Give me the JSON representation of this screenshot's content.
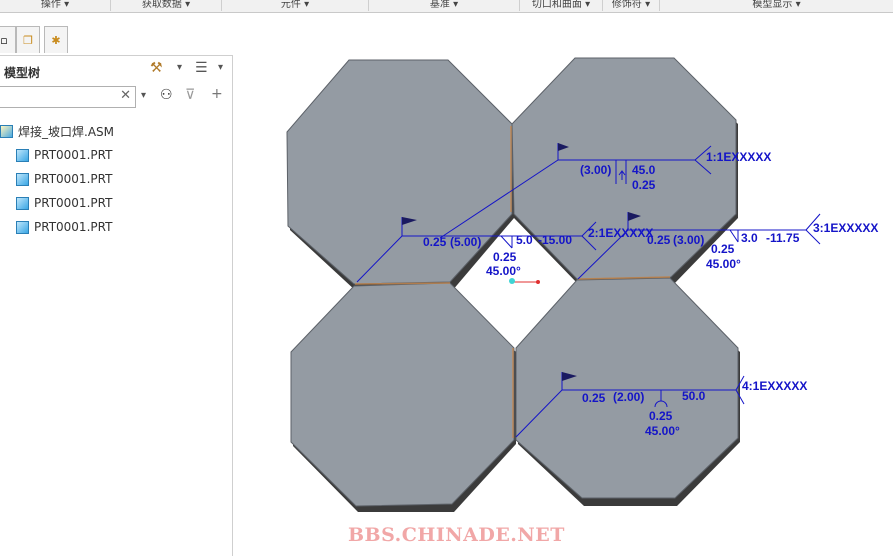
{
  "ribbon": {
    "groups": [
      "操作",
      "获取数据",
      "元件",
      "基准",
      "切口和曲面",
      "修饰符",
      "模型显示"
    ]
  },
  "panel": {
    "title": "模型树",
    "search_value": "",
    "tree": [
      {
        "label": "焊接_坡口焊.ASM",
        "type": "assembly"
      },
      {
        "label": "PRT0001.PRT",
        "type": "part"
      },
      {
        "label": "PRT0001.PRT",
        "type": "part"
      },
      {
        "label": "PRT0001.PRT",
        "type": "part"
      },
      {
        "label": "PRT0001.PRT",
        "type": "part"
      }
    ]
  },
  "welds": {
    "w1": {
      "ref": "1:1EXXXXX",
      "a": "(3.00)",
      "b": "45.0",
      "c": "0.25"
    },
    "w2": {
      "ref": "2:1EXXXXX",
      "a": "0.25",
      "b": "(5.00)",
      "c": "5.0",
      "d": "-15.00",
      "e": "0.25",
      "f": "45.00°"
    },
    "w3": {
      "ref": "3:1EXXXXX",
      "a": "0.25",
      "b": "(3.00)",
      "c": "3.0",
      "d": "-11.75",
      "e": "0.25",
      "f": "45.00°"
    },
    "w4": {
      "ref": "4:1EXXXXX",
      "a": "0.25",
      "b": "(2.00)",
      "c": "50.0",
      "d": "0.25",
      "e": "45.00°"
    }
  },
  "watermark": "BBS.CHINADE.NET",
  "colors": {
    "plate": "#949ba3",
    "plate_edge": "#3b3b3b",
    "annotation": "#1414c8",
    "weld": "#c8874a"
  }
}
